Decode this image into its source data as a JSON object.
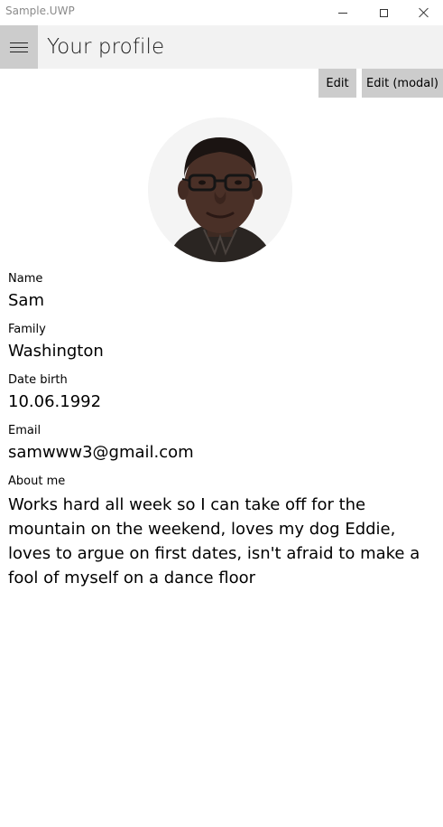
{
  "window": {
    "app_title": "Sample.UWP"
  },
  "header": {
    "title": "Your profile",
    "menu_icon": "hamburger-icon"
  },
  "toolbar": {
    "edit_label": "Edit",
    "edit_modal_label": "Edit (modal)"
  },
  "profile": {
    "avatar_icon": "profile-photo",
    "name_label": "Name",
    "name_value": "Sam",
    "family_label": "Family",
    "family_value": "Washington",
    "birth_label": "Date birth",
    "birth_value": "10.06.1992",
    "email_label": "Email",
    "email_value": "samwww3@gmail.com",
    "about_label": "About me",
    "about_value": "Works hard all week so I can take off for the mountain on the weekend, loves my dog Eddie, loves to argue on first dates, isn't afraid to make a fool of myself on a dance floor"
  },
  "colors": {
    "header_bg": "#f2f2f2",
    "menu_button_bg": "#cccccc",
    "command_button_bg": "#cccccc",
    "title_text": "#8a8a8a"
  }
}
